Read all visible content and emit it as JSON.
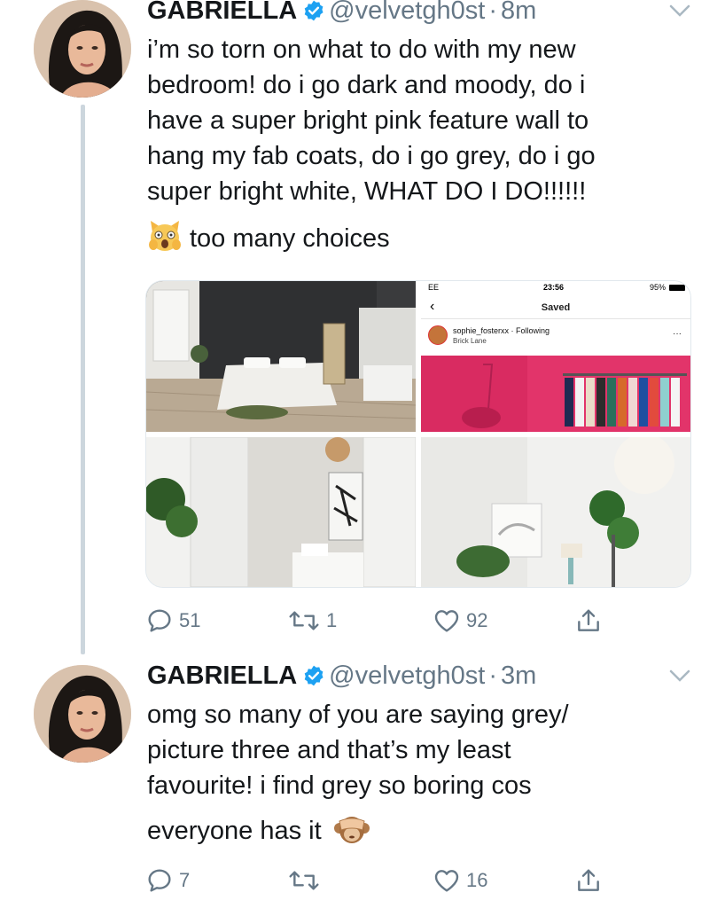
{
  "tweets": [
    {
      "name": "GABRIELLA",
      "handle": "@velvetgh0st",
      "sep": "·",
      "time": "8m",
      "lines": [
        "i’m so torn on what to do with my new",
        "bedroom! do i go dark and moody, do i",
        "have a super bright pink feature wall to",
        "hang my fab coats, do i go grey, do i go",
        "super bright white, WHAT DO I DO!!!!!!"
      ],
      "emoji_line": "too many choices",
      "emoji_icon": "screaming-cat-icon",
      "media": {
        "phone_status": {
          "carrier": "EE",
          "clock": "23:56",
          "battery": "95%"
        },
        "saved_title": "Saved",
        "post_user": "sophie_fosterxx",
        "post_follow": "Following",
        "post_location": "Brick Lane",
        "more": "···"
      },
      "actions": {
        "replies": "51",
        "retweets": "1",
        "likes": "92"
      }
    },
    {
      "name": "GABRIELLA",
      "handle": "@velvetgh0st",
      "sep": "·",
      "time": "3m",
      "lines": [
        "omg so many of you are saying grey/",
        "picture three and that’s my least",
        "favourite! i find grey so boring cos",
        "everyone has it"
      ],
      "emoji_icon": "see-no-evil-monkey-icon",
      "actions": {
        "replies": "7",
        "retweets": "",
        "likes": "16"
      }
    }
  ],
  "colors": {
    "verified": "#1da1f2",
    "secondary": "#657786",
    "thread_line": "#ccd6dd"
  }
}
